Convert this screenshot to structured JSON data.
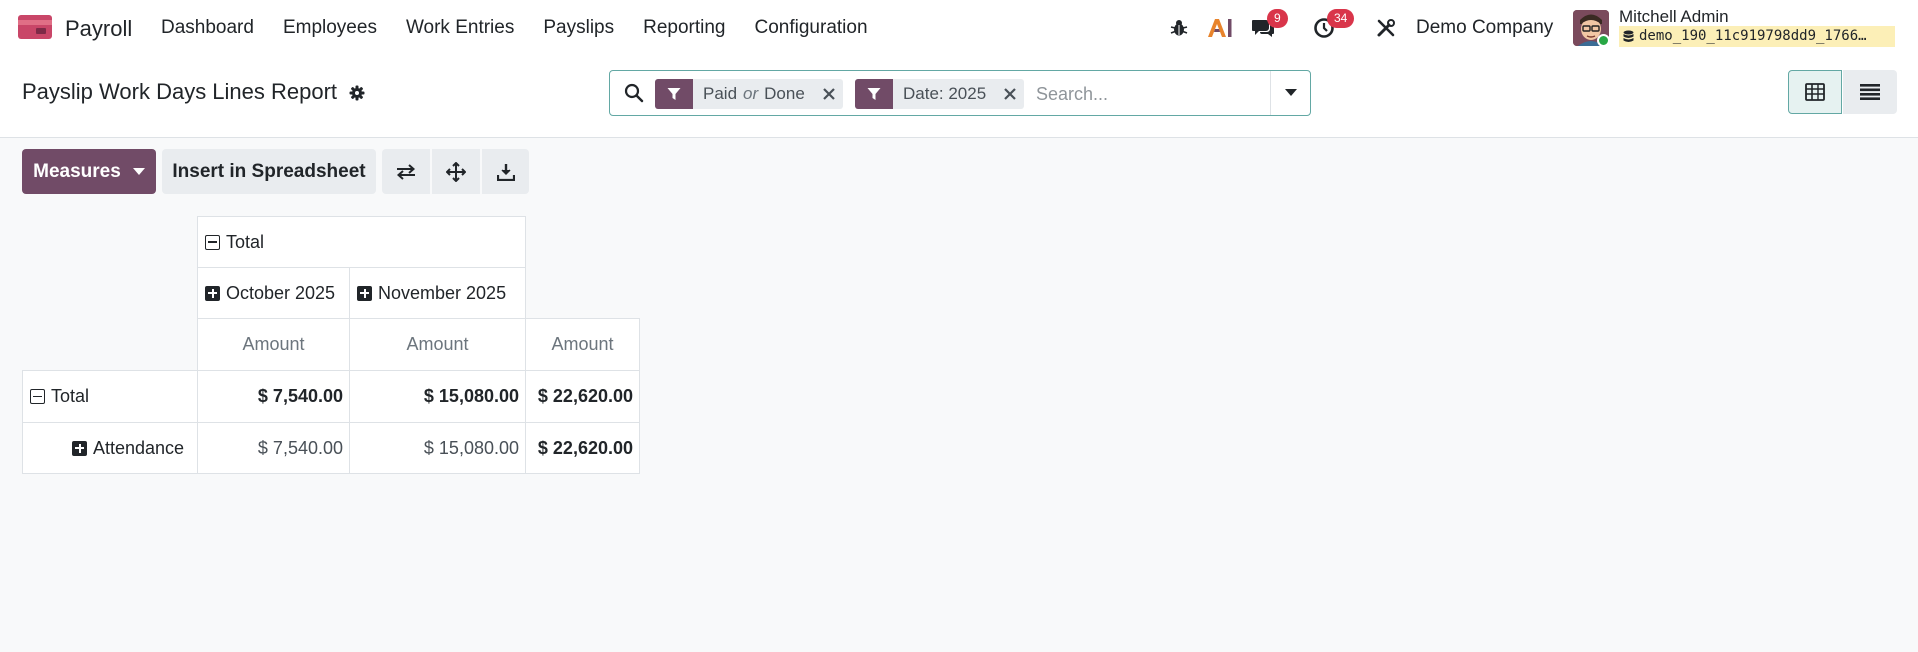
{
  "navbar": {
    "app_name": "Payroll",
    "menu": [
      "Dashboard",
      "Employees",
      "Work Entries",
      "Payslips",
      "Reporting",
      "Configuration"
    ],
    "systray": {
      "debug_icon": "bug-icon",
      "ai_icon": "ai-icon",
      "messages_badge": "9",
      "activities_badge": "34",
      "settings_icon": "tools-icon"
    },
    "company": "Demo Company",
    "user": {
      "name": "Mitchell Admin",
      "database": "demo_190_11c919798dd9_1766…"
    }
  },
  "control_panel": {
    "title": "Payslip Work Days Lines Report",
    "search": {
      "facets": [
        {
          "values": [
            "Paid",
            "Done"
          ],
          "separator": "or"
        },
        {
          "label": "Date: 2025"
        }
      ],
      "placeholder": "Search..."
    },
    "views": [
      "pivot",
      "list"
    ],
    "active_view": "pivot"
  },
  "pivot_buttons": {
    "measures": "Measures",
    "insert_spreadsheet": "Insert in Spreadsheet"
  },
  "pivot": {
    "col_header_total": "Total",
    "col_groups": [
      "October 2025",
      "November 2025"
    ],
    "measure_label": "Amount",
    "rows": [
      {
        "label": "Total",
        "expanded": true,
        "values": [
          "$ 7,540.00",
          "$ 15,080.00",
          "$ 22,620.00"
        ]
      },
      {
        "label": "Attendance",
        "expanded": false,
        "values": [
          "$ 7,540.00",
          "$ 15,080.00",
          "$ 22,620.00"
        ]
      }
    ]
  },
  "colors": {
    "brand": "#714b67",
    "accent_teal": "#63a8a4",
    "badge": "#d9354a"
  }
}
